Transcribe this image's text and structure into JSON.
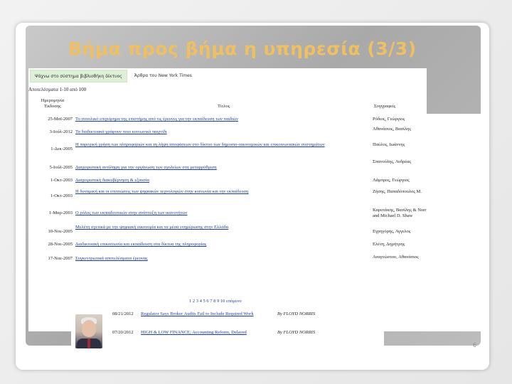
{
  "slide": {
    "title": "Βήμα προς βήμα η υπηρεσία (3/3)",
    "page_number": "6"
  },
  "browser": {
    "tabs": [
      {
        "label": "Ψάχνω στο σύστημα βιβλιοθήκη δίκτυος"
      },
      {
        "label": "Άρθρα του New York Times"
      }
    ],
    "results_count": "Αποτελέσματα 1-10 από 100",
    "headers": {
      "date": "Ημερομηνία Έκδοσης",
      "title": "Τίτλος",
      "author": "Συγγραφείς"
    },
    "rows": [
      {
        "date": "25-Μαϊ-2007",
        "title": "Το συνολικό επιχείρημα της επιστήμης από τις έρευνες για την εκπαίδευση των παιδιών",
        "author": "Ρόδιος, Γεώργιος"
      },
      {
        "date": "3-Ιούλ-2012",
        "title": "Τα διαδικτυακά γράφουν ποιο κοινωνικό παιχνίδι",
        "author": "Αθανάσιος, Βασίλης"
      },
      {
        "date": "1-Δεκ-2005",
        "title": "Η παροχική χρήση των πληροφοριών και τη λήψη αποφάσεων στο δίκτυο των δημοσιο-οικονομικών και επικοινωνιακών συστημάτων",
        "author": "Παύλος, Ιωάννης"
      },
      {
        "date": "5-Ιούλ-2005",
        "title": "Διαχειριστική αντίληψη για την οργάνωση των σχολείων στη μεταρρύθμιση",
        "author": "Σπανούλης, Ανδρέας"
      },
      {
        "date": "1-Οκτ-2003",
        "title": "Διαχειριστική διακυβέρνηση & εξουσία",
        "author": "Λάμπρος, Γεώργιος"
      },
      {
        "date": "1-Οκτ-2003",
        "title": "Η δυναμική και οι επιπτώσεις των ψηφιακών τεχνολογιών στην κοινωνία και την εκπαίδευση",
        "author": "Ζήσης, Παπαδόπουλος Μ."
      },
      {
        "date": "1-Μαρ-2003",
        "title": "Ο ρόλος των εκπαιδευτικών στην ανάπτυξη των ικανοτήτων",
        "author": "Καρυτάκης, Βασίλης & Norris and Michael D. Shaw"
      },
      {
        "date": "10-Νοε-2005",
        "title": "Μελέτη σχετικά με την ψηφιακή οικονομία και τα μέσα ενημέρωσης στην Ελλάδα",
        "author": "Εγρηγόρης, Αγγελος"
      },
      {
        "date": "28-Νοε-2005",
        "title": "Διαδικτυακή επικοινωνία και εκπαίδευση στα δίκτυα της πληροφορίας",
        "author": "Ελένη, Δημήτρης"
      },
      {
        "date": "17-Νοε-2007",
        "title": "Συγκεντρωτικά αποτελέσματα έρευνας",
        "author": "Αναγνώστου, Αθανάσιος"
      }
    ],
    "pager": "1 2 3 4 5 6 7 8 9 10 επόμενο",
    "news": [
      {
        "date": "08/21/2012",
        "title": "Regulator Says Broker Audits Fail to Include Required Work",
        "author": "By FLOYD NORRIS"
      },
      {
        "date": "07/20/2012",
        "title": "HIGH & LOW FINANCE; Accounting Reform, Delayed",
        "author": "By FLOYD NORRIS"
      }
    ]
  }
}
